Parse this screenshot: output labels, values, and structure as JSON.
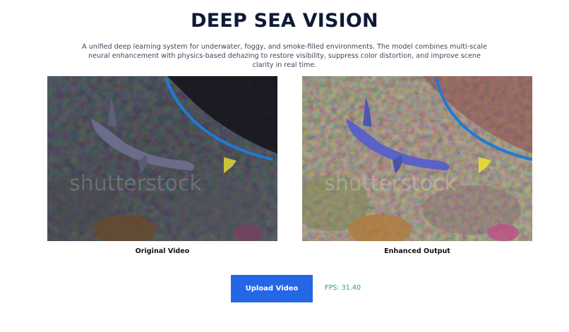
{
  "header": {
    "title": "DEEP SEA VISION",
    "description": "A unified deep learning system for underwater, foggy, and smoke-filled environments. The model combines multi-scale neural enhancement with physics-based dehazing to restore visibility, suppress color distortion, and improve scene clarity in real time."
  },
  "panels": {
    "original": {
      "caption": "Original Video",
      "watermark": "shutterstock"
    },
    "enhanced": {
      "caption": "Enhanced Output",
      "watermark": "shutterstock"
    }
  },
  "controls": {
    "upload_label": "Upload Video",
    "fps_text": "FPS: 31.40"
  },
  "colors": {
    "title": "#0f1b35",
    "button": "#2367e6",
    "fps": "#2fa84f"
  }
}
